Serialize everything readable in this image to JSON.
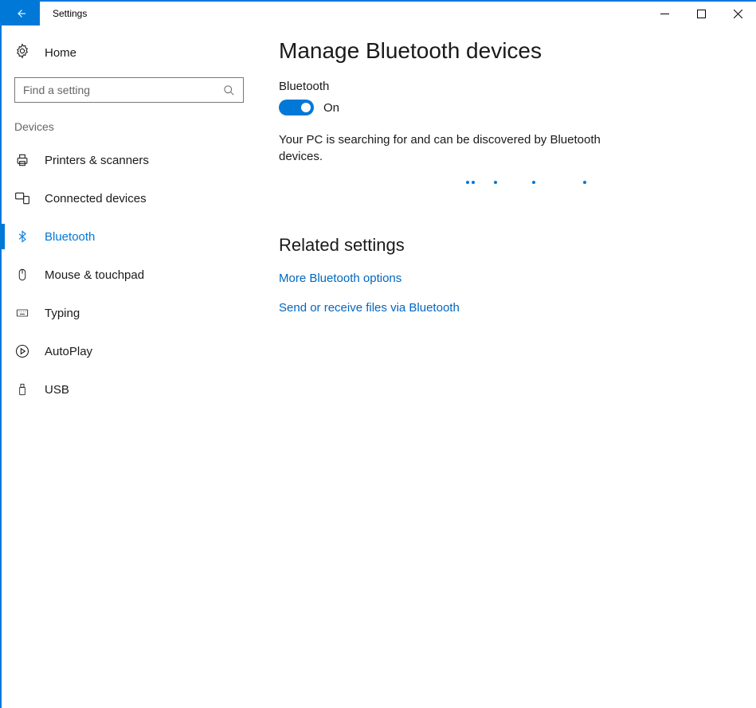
{
  "window": {
    "title": "Settings"
  },
  "sidebar": {
    "home_label": "Home",
    "search_placeholder": "Find a setting",
    "group_label": "Devices",
    "items": [
      {
        "icon": "printer-icon",
        "label": "Printers & scanners"
      },
      {
        "icon": "connected-devices-icon",
        "label": "Connected devices"
      },
      {
        "icon": "bluetooth-icon",
        "label": "Bluetooth"
      },
      {
        "icon": "mouse-icon",
        "label": "Mouse & touchpad"
      },
      {
        "icon": "keyboard-icon",
        "label": "Typing"
      },
      {
        "icon": "autoplay-icon",
        "label": "AutoPlay"
      },
      {
        "icon": "usb-icon",
        "label": "USB"
      }
    ],
    "selected_index": 2
  },
  "main": {
    "heading": "Manage Bluetooth devices",
    "toggle": {
      "label": "Bluetooth",
      "state_text": "On",
      "on": true
    },
    "status_text": "Your PC is searching for and can be discovered by Bluetooth devices.",
    "related_heading": "Related settings",
    "links": [
      "More Bluetooth options",
      "Send or receive files via Bluetooth"
    ]
  }
}
